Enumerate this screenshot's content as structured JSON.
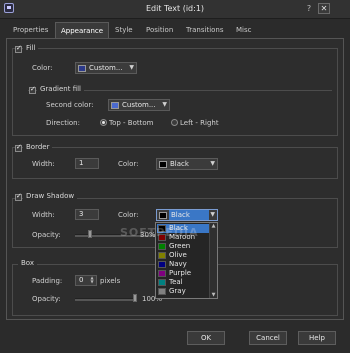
{
  "window": {
    "title": "Edit Text (id:1)",
    "close_symbol": "✕",
    "help_symbol": "?"
  },
  "tabs": [
    "Properties",
    "Appearance",
    "Style",
    "Position",
    "Transitions",
    "Misc"
  ],
  "fill": {
    "legend": "Fill",
    "checked": true,
    "color_label": "Color:",
    "color_value": "Custom...",
    "color_hex": "#2c3a8a",
    "gradient": {
      "legend": "Gradient fill",
      "checked": true,
      "second_color_label": "Second color:",
      "second_color_value": "Custom...",
      "second_color_hex": "#4b6ad0",
      "direction_label": "Direction:",
      "option_top_bottom": "Top - Bottom",
      "option_left_right": "Left - Right",
      "selected": "Top - Bottom"
    }
  },
  "border": {
    "legend": "Border",
    "checked": true,
    "width_label": "Width:",
    "width_value": "1",
    "color_label": "Color:",
    "color_value": "Black",
    "color_hex": "#000000"
  },
  "shadow": {
    "legend": "Draw Shadow",
    "checked": true,
    "width_label": "Width:",
    "width_value": "3",
    "color_label": "Color:",
    "color_value": "Black",
    "color_hex": "#000000",
    "opacity_label": "Opacity:",
    "opacity_value": "30%",
    "opacity_fraction": 0.3
  },
  "color_dropdown": {
    "items": [
      {
        "name": "Black",
        "hex": "#000000"
      },
      {
        "name": "Maroon",
        "hex": "#800000"
      },
      {
        "name": "Green",
        "hex": "#008000"
      },
      {
        "name": "Olive",
        "hex": "#808000"
      },
      {
        "name": "Navy",
        "hex": "#000080"
      },
      {
        "name": "Purple",
        "hex": "#800080"
      },
      {
        "name": "Teal",
        "hex": "#008080"
      },
      {
        "name": "Gray",
        "hex": "#808080"
      }
    ],
    "selected": "Black"
  },
  "box": {
    "legend": "Box",
    "padding_label": "Padding:",
    "padding_value": "0",
    "padding_unit": "pixels",
    "opacity_label": "Opacity:",
    "opacity_value": "100%",
    "opacity_fraction": 1.0
  },
  "buttons": {
    "ok": "OK",
    "cancel": "Cancel",
    "help": "Help"
  },
  "watermark": "SOFTPEDIA",
  "colors": {
    "accent": "#3a77c6",
    "background": "#2b2b2b"
  }
}
